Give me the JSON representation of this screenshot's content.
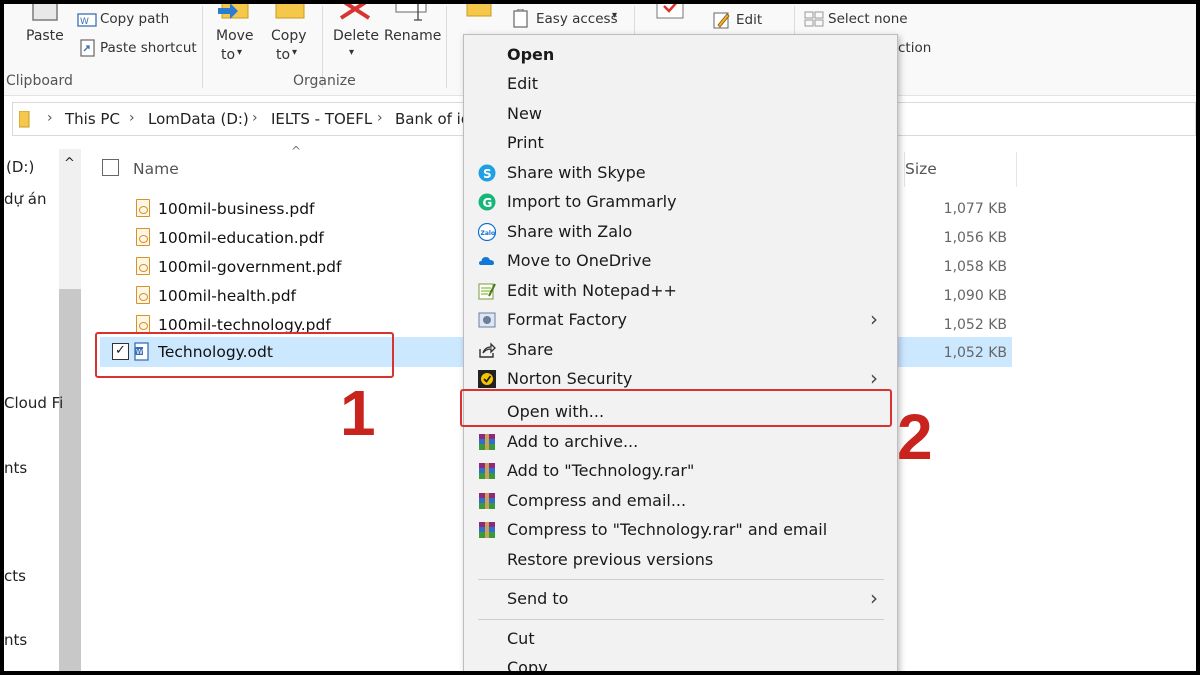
{
  "ribbon": {
    "clipboard": {
      "paste": "Paste",
      "copy_path": "Copy path",
      "paste_shortcut": "Paste shortcut",
      "group_label": "Clipboard"
    },
    "organize": {
      "move_to_line1": "Move",
      "move_to_line2": "to",
      "copy_to_line1": "Copy",
      "copy_to_line2": "to",
      "delete": "Delete",
      "rename": "Rename",
      "group_label": "Organize"
    },
    "new": {
      "easy_access": "Easy access"
    },
    "open": {
      "edit": "Edit"
    },
    "select": {
      "select_none": "Select none",
      "partial_text": "ction"
    }
  },
  "address_bar": {
    "crumbs": [
      "This PC",
      "LomData (D:)",
      "IELTS - TOEFL",
      "Bank of id"
    ]
  },
  "nav_pane": {
    "items": [
      "(D:)",
      "dự án",
      "Cloud Fi",
      "nts",
      "cts",
      "nts"
    ]
  },
  "file_list": {
    "headers": {
      "name": "Name",
      "size": "Size"
    },
    "files": [
      {
        "name": "100mil-business.pdf",
        "size": "1,077 KB"
      },
      {
        "name": "100mil-education.pdf",
        "size": "1,056 KB"
      },
      {
        "name": "100mil-government.pdf",
        "size": "1,058 KB"
      },
      {
        "name": "100mil-health.pdf",
        "size": "1,090 KB"
      },
      {
        "name": "100mil-technology.pdf",
        "size": "1,052 KB"
      },
      {
        "name": "Technology.odt",
        "size": "1,052 KB",
        "selected": true
      }
    ]
  },
  "context_menu": {
    "items": [
      {
        "label": "Open",
        "bold": true
      },
      {
        "label": "Edit"
      },
      {
        "label": "New"
      },
      {
        "label": "Print"
      },
      {
        "label": "Share with Skype",
        "icon": "skype-icon"
      },
      {
        "label": "Import to Grammarly",
        "icon": "grammarly-icon"
      },
      {
        "label": "Share with Zalo",
        "icon": "zalo-icon"
      },
      {
        "label": "Move to OneDrive",
        "icon": "onedrive-icon"
      },
      {
        "label": "Edit with Notepad++",
        "icon": "notepadpp-icon"
      },
      {
        "label": "Format Factory",
        "icon": "format-factory-icon",
        "submenu": true
      },
      {
        "label": "Share",
        "icon": "share-icon"
      },
      {
        "label": "Norton Security",
        "icon": "norton-icon",
        "submenu": true
      },
      {
        "label": "Open with..."
      },
      {
        "label": "Add to archive...",
        "icon": "winrar-icon"
      },
      {
        "label": "Add to \"Technology.rar\"",
        "icon": "winrar-icon"
      },
      {
        "label": "Compress and email...",
        "icon": "winrar-icon"
      },
      {
        "label": "Compress to \"Technology.rar\" and email",
        "icon": "winrar-icon"
      },
      {
        "label": "Restore previous versions"
      },
      {
        "label": "Send to",
        "submenu": true
      },
      {
        "label": "Cut"
      },
      {
        "label": "Copy"
      }
    ]
  },
  "annotations": {
    "step1": "1",
    "step2": "2"
  },
  "colors": {
    "highlight": "#cce8ff",
    "annotation_red": "#d9332f"
  }
}
